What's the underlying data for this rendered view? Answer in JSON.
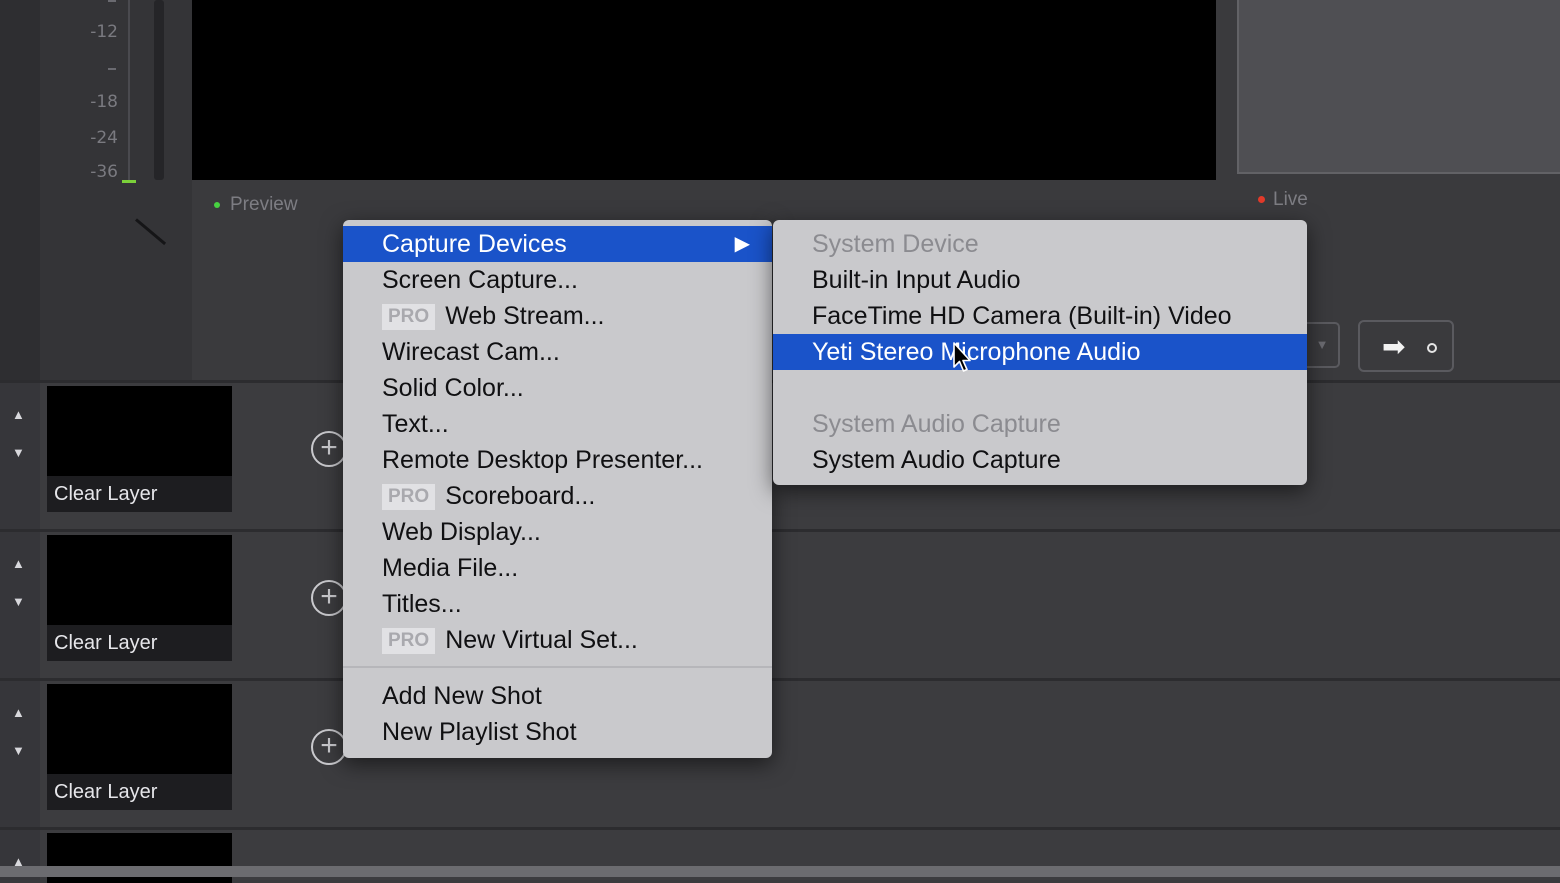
{
  "meter": {
    "db_labels": [
      "-12",
      "-18",
      "-24",
      "-36"
    ]
  },
  "preview": {
    "label": "Preview"
  },
  "live": {
    "label": "Live"
  },
  "layers": [
    {
      "label": "Clear Layer"
    },
    {
      "label": "Clear Layer"
    },
    {
      "label": "Clear Layer"
    }
  ],
  "menu": {
    "items": [
      {
        "label": "Capture Devices",
        "selected": true,
        "submenu": true
      },
      {
        "label": "Screen Capture..."
      },
      {
        "label": "Web Stream...",
        "pro": true
      },
      {
        "label": "Wirecast Cam..."
      },
      {
        "label": "Solid Color..."
      },
      {
        "label": "Text..."
      },
      {
        "label": "Remote Desktop Presenter..."
      },
      {
        "label": "Scoreboard...",
        "pro": true
      },
      {
        "label": "Web Display..."
      },
      {
        "label": "Media File..."
      },
      {
        "label": "Titles..."
      },
      {
        "label": "New Virtual Set...",
        "pro": true
      },
      {
        "label": "Add New Shot"
      },
      {
        "label": "New Playlist Shot"
      }
    ],
    "pro_badge": "PRO"
  },
  "submenu": {
    "items": [
      {
        "label": "System Device",
        "disabled": true
      },
      {
        "label": "Built-in Input Audio"
      },
      {
        "label": "FaceTime HD Camera (Built-in) Video"
      },
      {
        "label": "Yeti Stereo Microphone Audio",
        "selected": true
      },
      {
        "label": "System Audio Capture",
        "disabled": true
      },
      {
        "label": "System Audio Capture"
      }
    ]
  },
  "colors": {
    "selection": "#1a53c9",
    "menu_bg": "#c9c9cc",
    "preview_dot": "#47d141",
    "live_dot": "#e23a2a"
  }
}
